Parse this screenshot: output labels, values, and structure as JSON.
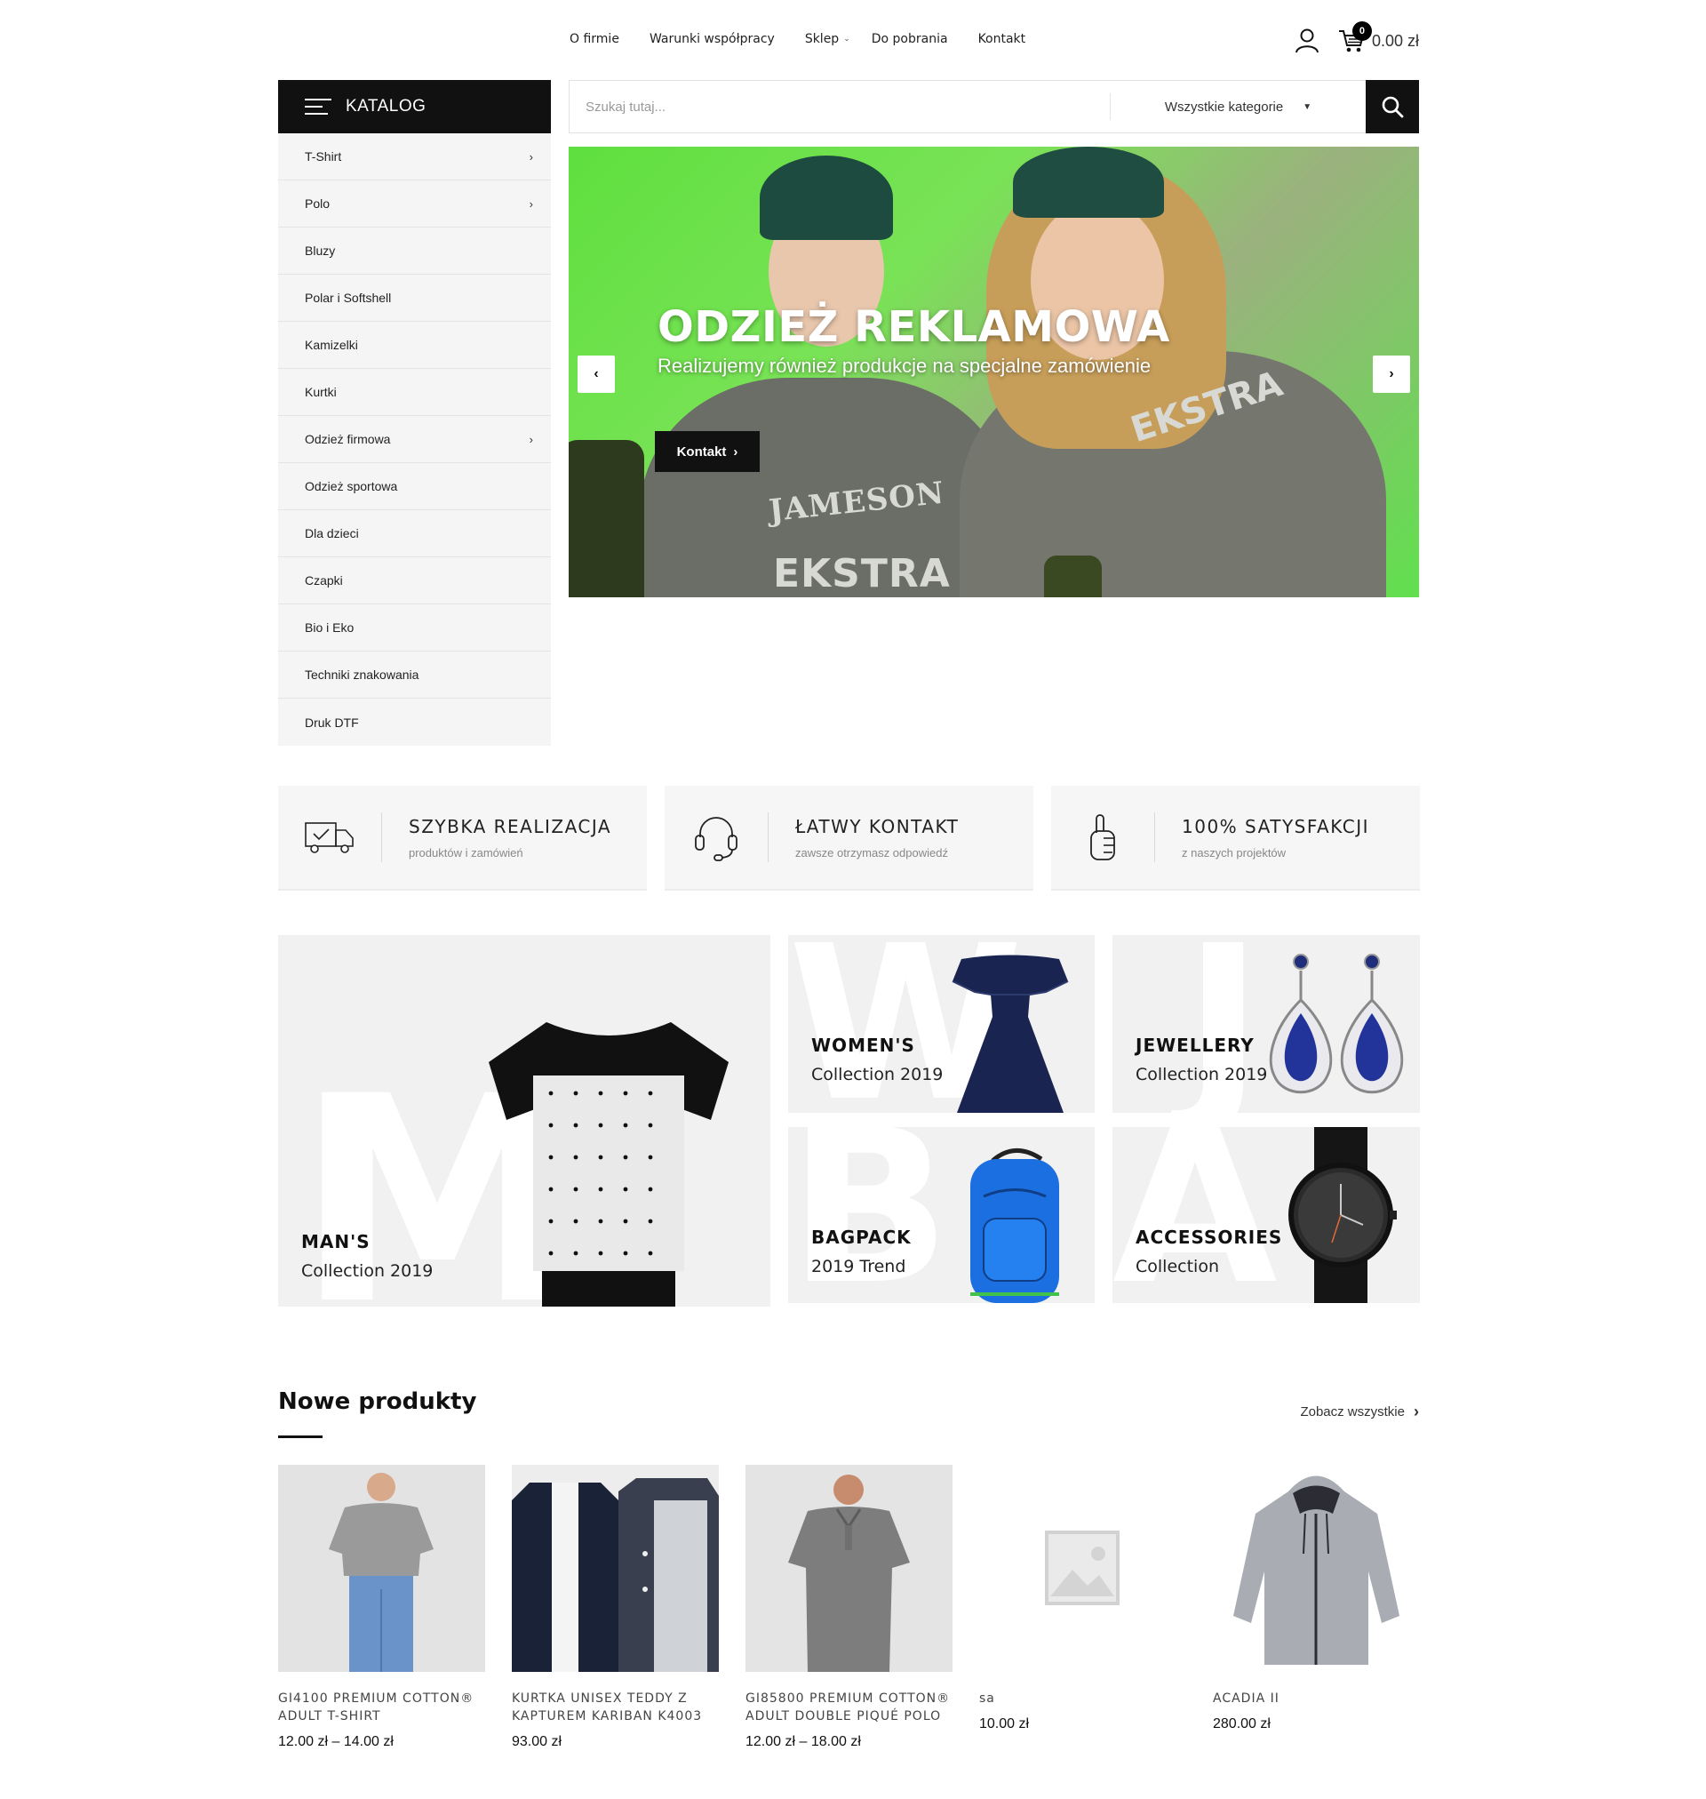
{
  "nav": {
    "items": [
      "O firmie",
      "Warunki współpracy",
      "Sklep",
      "Do pobrania",
      "Kontakt"
    ],
    "cart_count": "0",
    "cart_total": "0.00 zł"
  },
  "catalog": {
    "title": "KATALOG",
    "items": [
      {
        "label": "T-Shirt",
        "has_sub": true
      },
      {
        "label": "Polo",
        "has_sub": true
      },
      {
        "label": "Bluzy",
        "has_sub": false
      },
      {
        "label": "Polar i Softshell",
        "has_sub": false
      },
      {
        "label": "Kamizelki",
        "has_sub": false
      },
      {
        "label": "Kurtki",
        "has_sub": false
      },
      {
        "label": "Odzież firmowa",
        "has_sub": true
      },
      {
        "label": "Odzież sportowa",
        "has_sub": false
      },
      {
        "label": "Dla dzieci",
        "has_sub": false
      },
      {
        "label": "Czapki",
        "has_sub": false
      },
      {
        "label": "Bio i Eko",
        "has_sub": false
      },
      {
        "label": "Techniki znakowania",
        "has_sub": false
      },
      {
        "label": "Druk DTF",
        "has_sub": false
      }
    ]
  },
  "search": {
    "placeholder": "Szukaj tutaj...",
    "category": "Wszystkie kategorie"
  },
  "hero": {
    "title": "ODZIEŻ REKLAMOWA",
    "subtitle": "Realizujemy również produkcje na specjalne zamówienie",
    "cta": "Kontakt",
    "shirt_text_1": "JAMESON",
    "shirt_text_2": "EKSTRA",
    "shirt_text_3": "EKSTRA"
  },
  "features": [
    {
      "title": "SZYBKA REALIZACJA",
      "sub": "produktów i zamówień",
      "icon": "truck-icon"
    },
    {
      "title": "ŁATWY KONTAKT",
      "sub": "zawsze otrzymasz odpowiedź",
      "icon": "headset-icon"
    },
    {
      "title": "100% SATYSFAKCJI",
      "sub": "z naszych projektów",
      "icon": "thumbs-up-icon"
    }
  ],
  "banners": {
    "man": {
      "title": "MAN'S",
      "sub": "Collection 2019",
      "letter": "M"
    },
    "women": {
      "title": "WOMEN'S",
      "sub": "Collection 2019",
      "letter": "W"
    },
    "jewellery": {
      "title": "JEWELLERY",
      "sub": "Collection 2019",
      "letter": "J"
    },
    "bagpack": {
      "title": "BAGPACK",
      "sub": "2019 Trend",
      "letter": "B"
    },
    "accessories": {
      "title": "ACCESSORIES",
      "sub": "Collection",
      "letter": "A"
    }
  },
  "new_products": {
    "title": "Nowe produkty",
    "see_all": "Zobacz wszystkie",
    "items": [
      {
        "name": "GI4100 PREMIUM COTTON® ADULT T-SHIRT",
        "price": "12.00 zł – 14.00 zł"
      },
      {
        "name": "KURTKA UNISEX TEDDY Z KAPTUREM KARIBAN K4003",
        "price": "93.00 zł"
      },
      {
        "name": "GI85800 PREMIUM COTTON® ADULT DOUBLE PIQUÉ POLO",
        "price": "12.00 zł – 18.00 zł"
      },
      {
        "name": "sa",
        "price": "10.00 zł"
      },
      {
        "name": "ACADIA II",
        "price": "280.00 zł"
      }
    ]
  }
}
